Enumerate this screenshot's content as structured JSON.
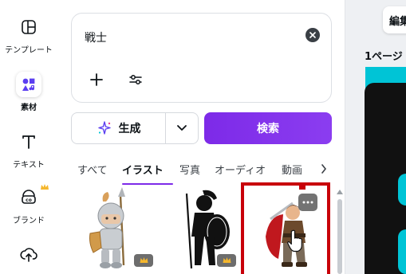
{
  "rail": {
    "items": [
      {
        "label": "テンプレート",
        "icon": "template-icon"
      },
      {
        "label": "素材",
        "icon": "elements-icon",
        "active": true
      },
      {
        "label": "テキスト",
        "icon": "text-icon"
      },
      {
        "label": "ブランド",
        "icon": "brand-icon",
        "premium": true
      },
      {
        "label": "",
        "icon": "upload-icon"
      }
    ]
  },
  "search": {
    "query": "戦士"
  },
  "actions": {
    "generate_label": "生成",
    "search_label": "検索"
  },
  "tabs": {
    "items": [
      "すべて",
      "イラスト",
      "写真",
      "オーディオ",
      "動画"
    ],
    "active": "イラスト"
  },
  "results": [
    {
      "subject": "chibi armored knight with spear",
      "premium": true
    },
    {
      "subject": "spartan warrior silhouette with shield",
      "premium": true
    },
    {
      "subject": "warrior with sword and red cape",
      "selected": true
    }
  ],
  "editor": {
    "edit_button_label": "編集",
    "page_label": "1ページ"
  },
  "colors": {
    "accent": "#7d2ae8",
    "selection": "#c8000a",
    "canvas": "#00c4d6",
    "premium_crown": "#f5b72d"
  }
}
